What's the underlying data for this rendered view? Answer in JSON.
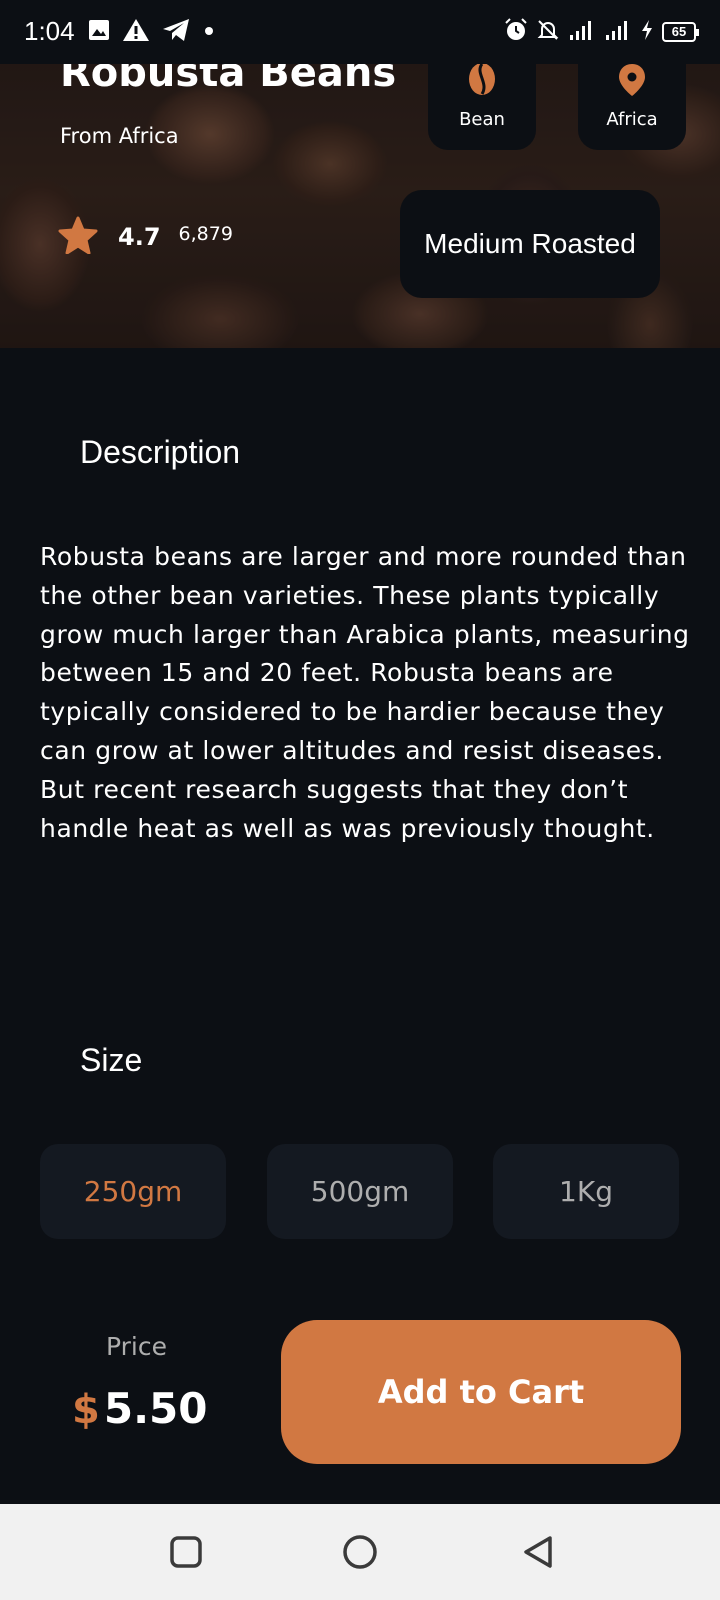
{
  "status_bar": {
    "time": "1:04",
    "battery": "65",
    "icons": [
      "image-icon",
      "warning-icon",
      "telegram-icon",
      "dot-icon",
      "alarm-icon",
      "mute-icon",
      "signal-icon",
      "signal-icon",
      "charging-icon",
      "battery-icon"
    ]
  },
  "product": {
    "name": "Robusta Beans",
    "origin_text": "From Africa",
    "rating": "4.7",
    "rating_count": "6,879",
    "roast": "Medium Roasted",
    "chips": [
      {
        "label": "Bean",
        "icon": "bean-icon"
      },
      {
        "label": "Africa",
        "icon": "location-pin-icon"
      }
    ]
  },
  "description": {
    "title": "Description",
    "text": "Robusta beans are larger and more rounded than the other bean varieties. These plants typically grow much larger than Arabica plants, measuring between 15 and 20 feet. Robusta beans are typically considered to be hardier because they can grow at lower altitudes and resist diseases. But recent research suggests that they don’t handle heat as well as was previously thought."
  },
  "size": {
    "title": "Size",
    "options": [
      "250gm",
      "500gm",
      "1Kg"
    ],
    "selected": "250gm"
  },
  "price": {
    "label": "Price",
    "currency": "$",
    "value": "5.50"
  },
  "cart_button": "Add to Cart",
  "colors": {
    "background": "#0C0F14",
    "accent": "#D17842",
    "card": "#141921",
    "muted_text": "#AEAEAE",
    "nav_bar": "#F1F1F1"
  },
  "nav": [
    "recent-apps-icon",
    "home-icon",
    "back-icon"
  ]
}
